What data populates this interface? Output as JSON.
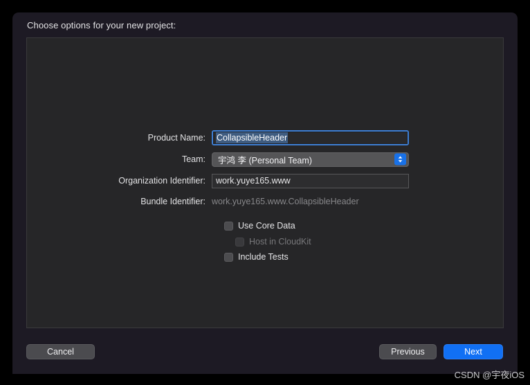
{
  "dialog": {
    "title": "Choose options for your new project:"
  },
  "form": {
    "product_name": {
      "label": "Product Name:",
      "value": "CollapsibleHeader"
    },
    "team": {
      "label": "Team:",
      "value": "宇鸿 李 (Personal Team)"
    },
    "organization_identifier": {
      "label": "Organization Identifier:",
      "value": "work.yuye165.www"
    },
    "bundle_identifier": {
      "label": "Bundle Identifier:",
      "value": "work.yuye165.www.CollapsibleHeader"
    }
  },
  "checkboxes": [
    {
      "label": "Use Core Data",
      "checked": false,
      "disabled": false
    },
    {
      "label": "Host in CloudKit",
      "checked": false,
      "disabled": true
    },
    {
      "label": "Include Tests",
      "checked": false,
      "disabled": false
    }
  ],
  "footer": {
    "cancel": "Cancel",
    "previous": "Previous",
    "next": "Next"
  },
  "watermark": "CSDN @宇夜iOS",
  "colors": {
    "accent_blue": "#1170f4",
    "focus_ring": "#3e7fd4",
    "selection": "#3f5c80",
    "dialog_bg": "#1d1a24",
    "panel_bg": "#262628"
  }
}
